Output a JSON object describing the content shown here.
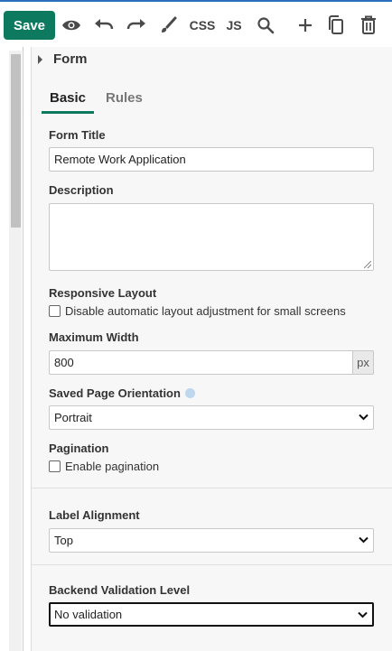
{
  "toolbar": {
    "save_label": "Save",
    "css_label": "CSS",
    "js_label": "JS",
    "icons": [
      "eye-icon",
      "undo-icon",
      "redo-icon",
      "brush-icon",
      "search-icon",
      "plus-icon",
      "copy-icon",
      "trash-icon"
    ]
  },
  "section": {
    "title": "Form"
  },
  "tabs": [
    {
      "label": "Basic",
      "active": true
    },
    {
      "label": "Rules",
      "active": false
    }
  ],
  "form_title": {
    "label": "Form Title",
    "value": "Remote Work Application"
  },
  "description": {
    "label": "Description",
    "value": ""
  },
  "responsive_layout": {
    "label": "Responsive Layout",
    "checkbox_label": "Disable automatic layout adjustment for small screens",
    "checked": false
  },
  "maximum_width": {
    "label": "Maximum Width",
    "value": "800",
    "unit": "px"
  },
  "saved_page_orientation": {
    "label": "Saved Page Orientation",
    "value": "Portrait"
  },
  "pagination": {
    "label": "Pagination",
    "checkbox_label": "Enable pagination",
    "checked": false
  },
  "label_alignment": {
    "label": "Label Alignment",
    "value": "Top"
  },
  "backend_validation": {
    "label": "Backend Validation Level",
    "value": "No validation"
  },
  "colors": {
    "accent": "#0d7a5f",
    "toolbar_top_border": "#2a6fbd",
    "panel_bg": "#f7f7f7"
  }
}
